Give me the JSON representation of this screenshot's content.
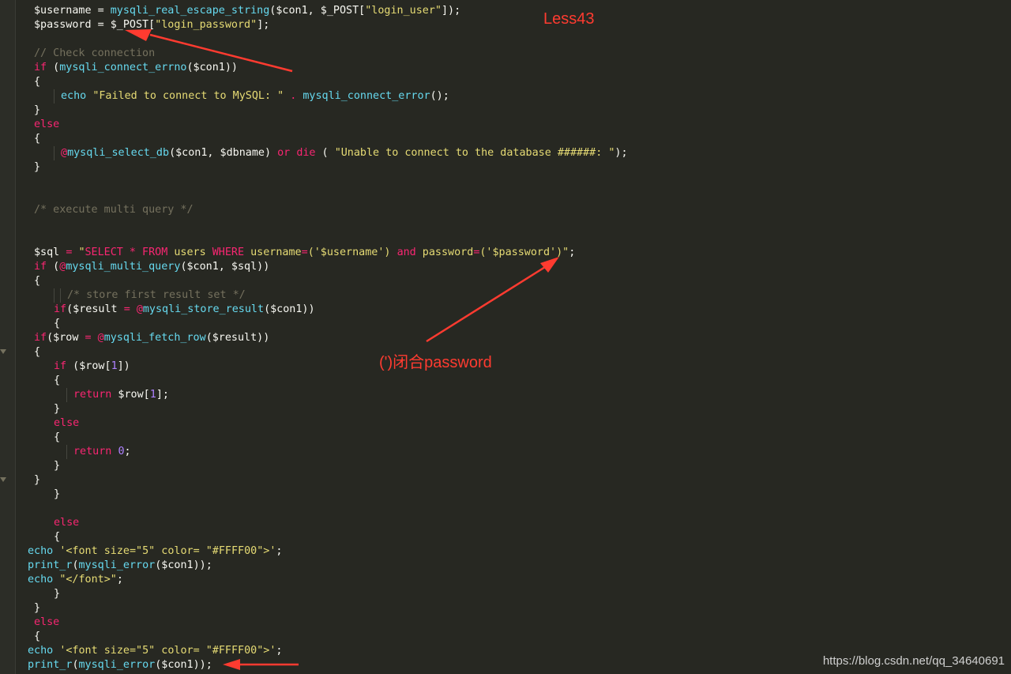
{
  "annotations": {
    "title": "Less43",
    "closure_note": "(')闭合password",
    "watermark": "https://blog.csdn.net/qq_34640691"
  },
  "colors": {
    "background": "#272822",
    "annotation_red": "#ff3b30",
    "string": "#e6db74",
    "keyword": "#f92672",
    "function": "#66d9ef",
    "comment": "#75715e",
    "number": "#ae81ff"
  },
  "code_lines": [
    [
      [
        "plain",
        "$username = "
      ],
      [
        "fn",
        "mysqli_real_escape_string"
      ],
      [
        "plain",
        "($con1, $_POST["
      ],
      [
        "str",
        "\"login_user\""
      ],
      [
        "plain",
        "]);"
      ]
    ],
    [
      [
        "plain",
        "$password = $_POST["
      ],
      [
        "str",
        "\"login_password\""
      ],
      [
        "plain",
        "];"
      ]
    ],
    [],
    [
      [
        "cmt",
        "// Check connection"
      ]
    ],
    [
      [
        "kw",
        "if"
      ],
      [
        "plain",
        " ("
      ],
      [
        "fn",
        "mysqli_connect_errno"
      ],
      [
        "plain",
        "($con1))"
      ]
    ],
    [
      [
        "plain",
        "{"
      ]
    ],
    [
      [
        "fn",
        "echo"
      ],
      [
        "plain",
        " "
      ],
      [
        "str",
        "\"Failed to connect to MySQL: \""
      ],
      [
        "plain",
        " "
      ],
      [
        "kw",
        "."
      ],
      [
        "plain",
        " "
      ],
      [
        "fn",
        "mysqli_connect_error"
      ],
      [
        "plain",
        "();"
      ]
    ],
    [
      [
        "plain",
        "}"
      ]
    ],
    [
      [
        "kw",
        "else"
      ]
    ],
    [
      [
        "plain",
        "{"
      ]
    ],
    [
      [
        "kw",
        "@"
      ],
      [
        "fn",
        "mysqli_select_db"
      ],
      [
        "plain",
        "($con1, $dbname) "
      ],
      [
        "kw",
        "or"
      ],
      [
        "plain",
        " "
      ],
      [
        "kw",
        "die"
      ],
      [
        "plain",
        " ( "
      ],
      [
        "str",
        "\"Unable to connect to the database ######: \""
      ],
      [
        "plain",
        ");"
      ]
    ],
    [
      [
        "plain",
        "}"
      ]
    ],
    [],
    [],
    [
      [
        "cmt",
        "/* execute multi query */"
      ]
    ],
    [],
    [],
    [
      [
        "plain",
        "$sql "
      ],
      [
        "kw",
        "="
      ],
      [
        "plain",
        " "
      ],
      [
        "str",
        "\""
      ],
      [
        "kw",
        "SELECT * FROM"
      ],
      [
        "str",
        " users "
      ],
      [
        "kw",
        "WHERE"
      ],
      [
        "str",
        " username"
      ],
      [
        "kw",
        "="
      ],
      [
        "str",
        "('$username') "
      ],
      [
        "kw",
        "and"
      ],
      [
        "str",
        " password"
      ],
      [
        "kw",
        "="
      ],
      [
        "str",
        "('$password')\""
      ],
      [
        "plain",
        ";"
      ]
    ],
    [
      [
        "kw",
        "if"
      ],
      [
        "plain",
        " ("
      ],
      [
        "kw",
        "@"
      ],
      [
        "fn",
        "mysqli_multi_query"
      ],
      [
        "plain",
        "($con1, $sql))"
      ]
    ],
    [
      [
        "plain",
        "{"
      ]
    ],
    [
      [
        "cmt",
        "/* store first result set */"
      ]
    ],
    [
      [
        "kw",
        "if"
      ],
      [
        "plain",
        "($result "
      ],
      [
        "kw",
        "="
      ],
      [
        "plain",
        " "
      ],
      [
        "kw",
        "@"
      ],
      [
        "fn",
        "mysqli_store_result"
      ],
      [
        "plain",
        "($con1))"
      ]
    ],
    [
      [
        "plain",
        "{"
      ]
    ],
    [
      [
        "kw",
        "if"
      ],
      [
        "plain",
        "($row "
      ],
      [
        "kw",
        "="
      ],
      [
        "plain",
        " "
      ],
      [
        "kw",
        "@"
      ],
      [
        "fn",
        "mysqli_fetch_row"
      ],
      [
        "plain",
        "($result))"
      ]
    ],
    [
      [
        "plain",
        "{"
      ]
    ],
    [
      [
        "kw",
        "if"
      ],
      [
        "plain",
        " ($row["
      ],
      [
        "num",
        "1"
      ],
      [
        "plain",
        "])"
      ]
    ],
    [
      [
        "plain",
        "{"
      ]
    ],
    [
      [
        "kw",
        "return"
      ],
      [
        "plain",
        " $row["
      ],
      [
        "num",
        "1"
      ],
      [
        "plain",
        "];"
      ]
    ],
    [
      [
        "plain",
        "}"
      ]
    ],
    [
      [
        "kw",
        "else"
      ]
    ],
    [
      [
        "plain",
        "{"
      ]
    ],
    [
      [
        "kw",
        "return"
      ],
      [
        "plain",
        " "
      ],
      [
        "num",
        "0"
      ],
      [
        "plain",
        ";"
      ]
    ],
    [
      [
        "plain",
        "}"
      ]
    ],
    [
      [
        "plain",
        "}"
      ]
    ],
    [
      [
        "plain",
        "}"
      ]
    ],
    [],
    [
      [
        "kw",
        "else"
      ]
    ],
    [
      [
        "plain",
        "{"
      ]
    ],
    [
      [
        "fn",
        "echo"
      ],
      [
        "plain",
        " "
      ],
      [
        "str",
        "'<font size=\"5\" color= \"#FFFF00\">'"
      ],
      [
        "plain",
        ";"
      ]
    ],
    [
      [
        "fn",
        "print_r"
      ],
      [
        "plain",
        "("
      ],
      [
        "fn",
        "mysqli_error"
      ],
      [
        "plain",
        "($con1));"
      ]
    ],
    [
      [
        "fn",
        "echo"
      ],
      [
        "plain",
        " "
      ],
      [
        "str",
        "\"</font>\""
      ],
      [
        "plain",
        ";"
      ]
    ],
    [
      [
        "plain",
        "}"
      ]
    ],
    [
      [
        "plain",
        "}"
      ]
    ],
    [
      [
        "kw",
        "else"
      ]
    ],
    [
      [
        "plain",
        "{"
      ]
    ],
    [
      [
        "fn",
        "echo"
      ],
      [
        "plain",
        " "
      ],
      [
        "str",
        "'<font size=\"5\" color= \"#FFFF00\">'"
      ],
      [
        "plain",
        ";"
      ]
    ],
    [
      [
        "fn",
        "print_r"
      ],
      [
        "plain",
        "("
      ],
      [
        "fn",
        "mysqli_error"
      ],
      [
        "plain",
        "($con1));"
      ]
    ]
  ]
}
